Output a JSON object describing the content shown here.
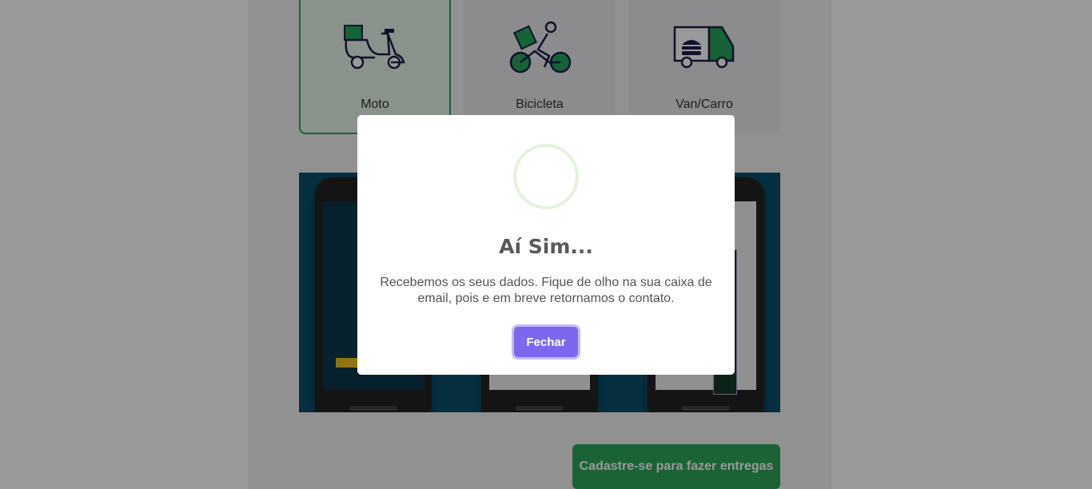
{
  "vehicles": [
    {
      "label": "Moto",
      "icon": "scooter-icon",
      "selected": true
    },
    {
      "label": "Bicicleta",
      "icon": "bicycle-courier-icon",
      "selected": false
    },
    {
      "label": "Van/Carro",
      "icon": "delivery-van-icon",
      "selected": false
    }
  ],
  "register_button": {
    "label": "Cadastre-se para fazer entregas"
  },
  "modal": {
    "icon": "success-circle-icon",
    "title": "Aí Sim...",
    "text": "Recebemos os seus dados. Fique de olho na sua caixa de email, pois e em breve retornamos o contato.",
    "close_label": "Fechar"
  },
  "colors": {
    "primary_green": "#2ea55a",
    "modal_button": "#7b68ee",
    "banner_bg": "#0a4f6b",
    "overlay": "rgba(0,0,0,0.4)"
  }
}
